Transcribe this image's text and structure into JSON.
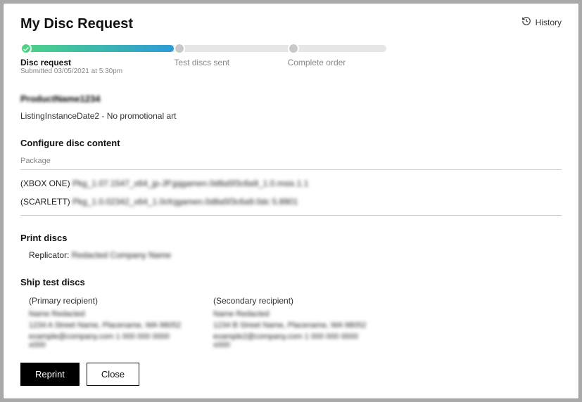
{
  "header": {
    "title": "My Disc Request",
    "history_label": "History"
  },
  "progress": {
    "steps": [
      {
        "label": "Disc request",
        "sub": "Submitted 03/05/2021 at 5:30pm",
        "state": "done"
      },
      {
        "label": "Test discs sent",
        "sub": "",
        "state": "pending"
      },
      {
        "label": "Complete order",
        "sub": "",
        "state": "pending"
      }
    ]
  },
  "product": {
    "name": "ProductName1234",
    "listing": "ListingInstanceDate2 - No promotional art"
  },
  "configure": {
    "title": "Configure disc content",
    "package_label": "Package",
    "packages": [
      {
        "platform": "(XBOX ONE) ",
        "file": "Pkg_1.07.1547_x64_jp-JP.jpjgamen.0d8a5f3c6a9_1.0.msix.1.1"
      },
      {
        "platform": "(SCARLETT) ",
        "file": "Pkg_1.0.02342_x64_1.0cfcjgamen.0d8a5f3c6a9.0dc 5.8901"
      }
    ]
  },
  "print": {
    "title": "Print discs",
    "replicator_label": "Replicator: ",
    "replicator_value": "Redacted Company Name"
  },
  "ship": {
    "title": "Ship test discs",
    "primary": {
      "label": "(Primary recipient)",
      "name": "Name Redacted",
      "addr": "1234 A Street Name, Placename, WA 98052",
      "contact": "example@company.com  1 000 000 0000 x000"
    },
    "secondary": {
      "label": "(Secondary recipient)",
      "name": "Name Redacted",
      "addr": "1234 B Street Name, Placename, WA 98052",
      "contact": "example2@company.com  1 000 000 0000 x000"
    }
  },
  "footer": {
    "reprint": "Reprint",
    "close": "Close"
  }
}
